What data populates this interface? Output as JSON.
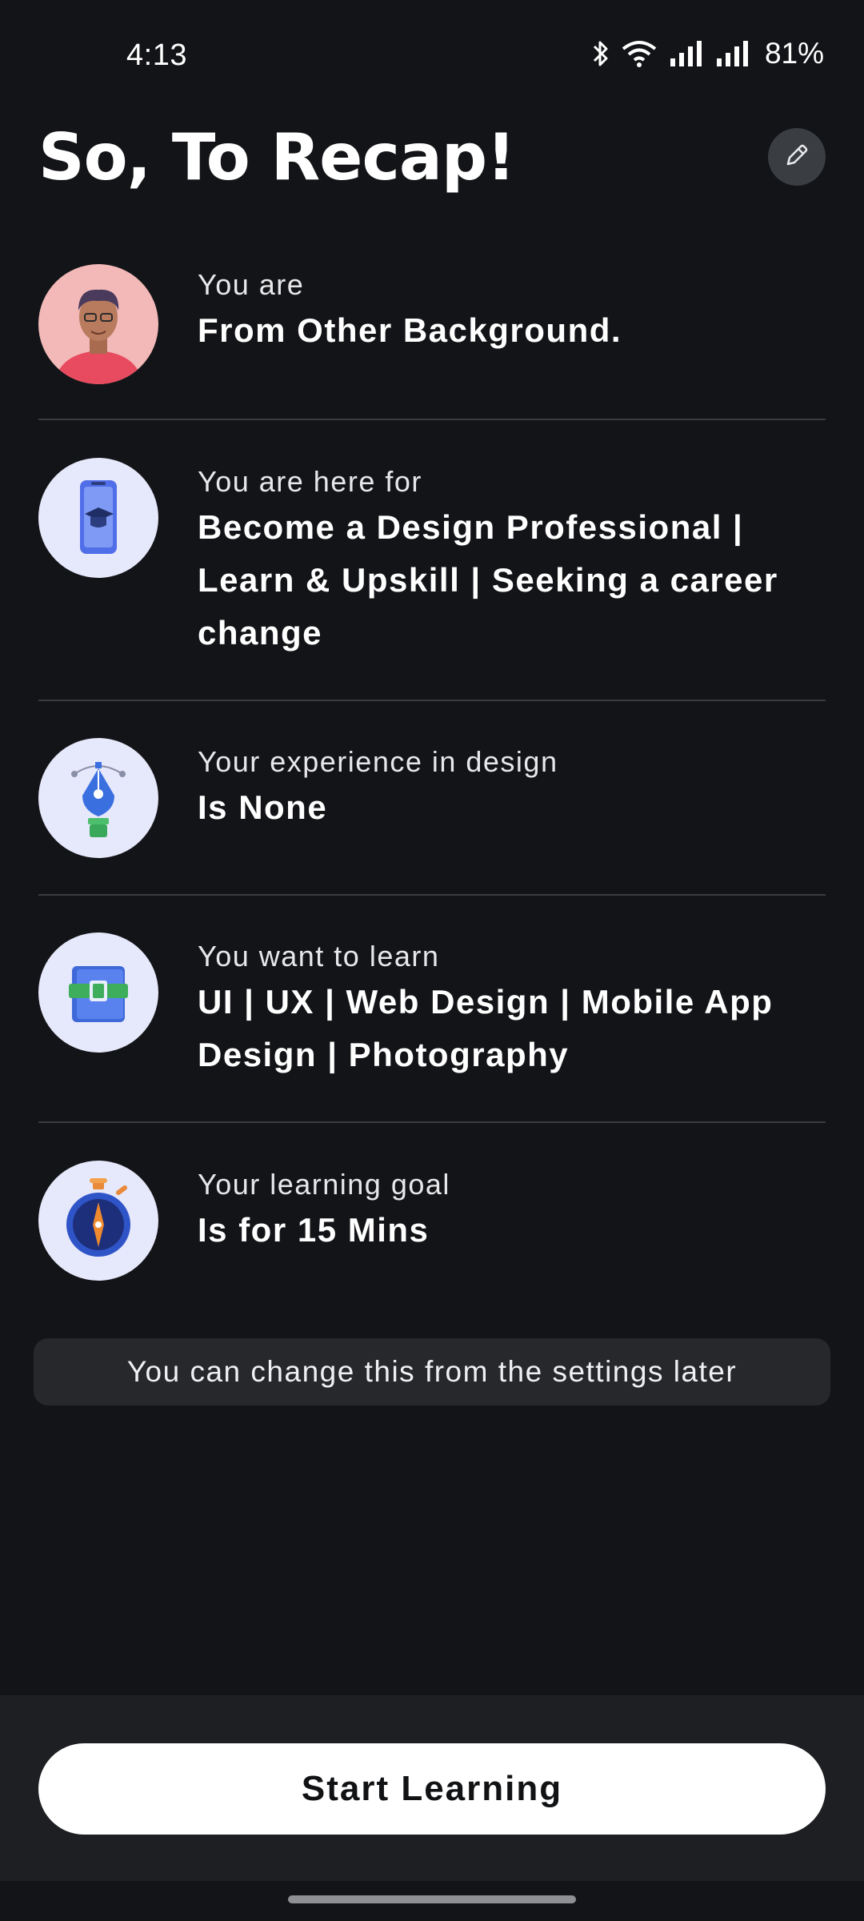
{
  "status_bar": {
    "time": "4:13",
    "battery": "81%",
    "icons": [
      "bluetooth-icon",
      "wifi-icon",
      "signal-icon",
      "signal-icon",
      "battery"
    ]
  },
  "header": {
    "title": "So, To Recap!",
    "edit_icon": "pencil-icon"
  },
  "recap": [
    {
      "label": "You are",
      "value": "From Other Background.",
      "icon": "person-avatar"
    },
    {
      "label": "You are here for",
      "value": "Become a Design Professional | Learn & Upskill | Seeking a career change",
      "icon": "phone-graduation-icon"
    },
    {
      "label": "Your experience in design",
      "value": "Is None",
      "icon": "pen-tool-icon"
    },
    {
      "label": "You want to learn",
      "value": "UI | UX | Web Design | Mobile App Design | Photography",
      "icon": "book-icon"
    },
    {
      "label": "Your learning goal",
      "value": "Is for 15 Mins",
      "icon": "stopwatch-icon"
    }
  ],
  "note": "You can change this from the settings later",
  "cta": {
    "label": "Start Learning"
  },
  "colors": {
    "background": "#131417",
    "accent_bg": "#e6e8fb",
    "button": "#ffffff"
  }
}
